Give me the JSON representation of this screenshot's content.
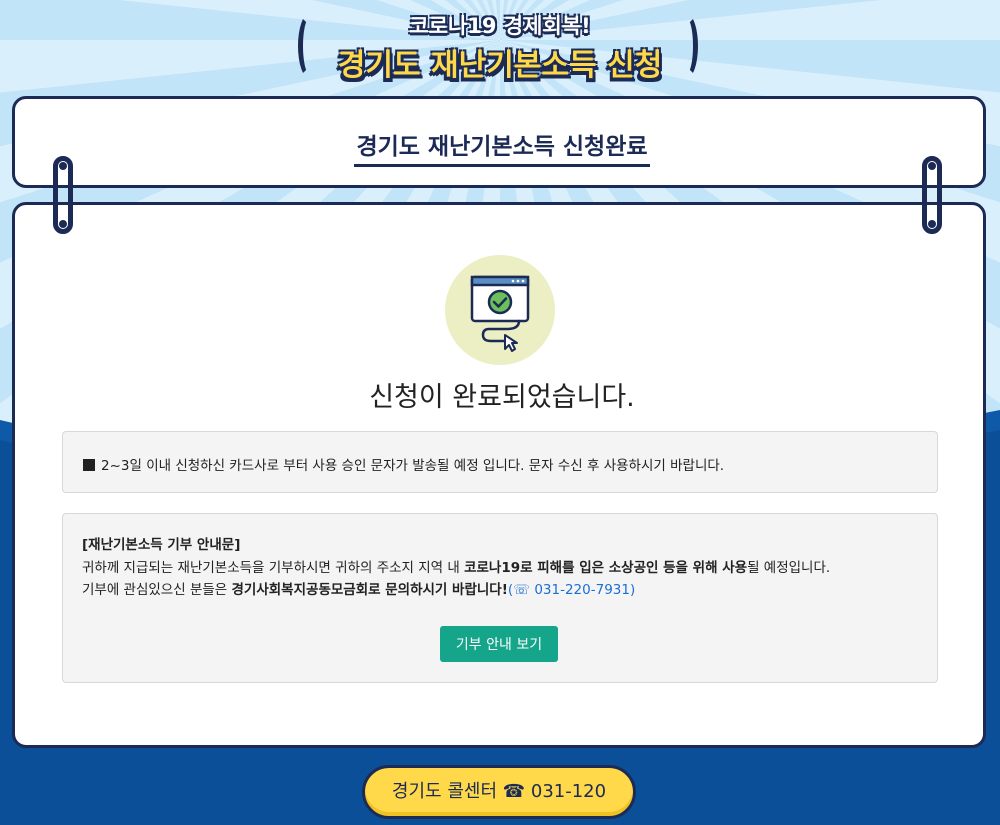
{
  "hero": {
    "line1": "코로나19 경제회복!",
    "line2": "경기도 재난기본소득 신청"
  },
  "title_card": {
    "title": "경기도 재난기본소득 신청완료"
  },
  "main": {
    "complete_message": "신청이 완료되었습니다.",
    "notice": "2~3일 이내 신청하신 카드사로 부터 사용 승인 문자가 발송될 예정 입니다. 문자 수신 후 사용하시기 바랍니다.",
    "donation": {
      "heading": "[재난기본소득 기부 안내문]",
      "line1_prefix": "귀하께 지급되는 재난기본소득을 기부하시면 귀하의 주소지 지역 내 ",
      "line1_bold": "코로나19로 피해를 입은 소상공인 등을 위해 사용",
      "line1_suffix": "될 예정입니다.",
      "line2_prefix": "기부에 관심있으신 분들은 ",
      "line2_bold": "경기사회복지공동모금회로 문의하시기 바랍니다!",
      "phone": "(☏ 031-220-7931)",
      "button_label": "기부 안내 보기"
    }
  },
  "call_center": {
    "label": "경기도 콜센터 ☎ 031-120"
  },
  "colors": {
    "navy": "#1b2b55",
    "sky": "#cfeafb",
    "deep_blue": "#0f5aa8",
    "green_button": "#14a58a",
    "yellow": "#ffd94a",
    "icon_circle": "#eceec4",
    "link_blue": "#1a6fd6"
  },
  "icons": {
    "complete": "browser-checkmark-cursor-icon",
    "phone": "telephone-icon"
  }
}
